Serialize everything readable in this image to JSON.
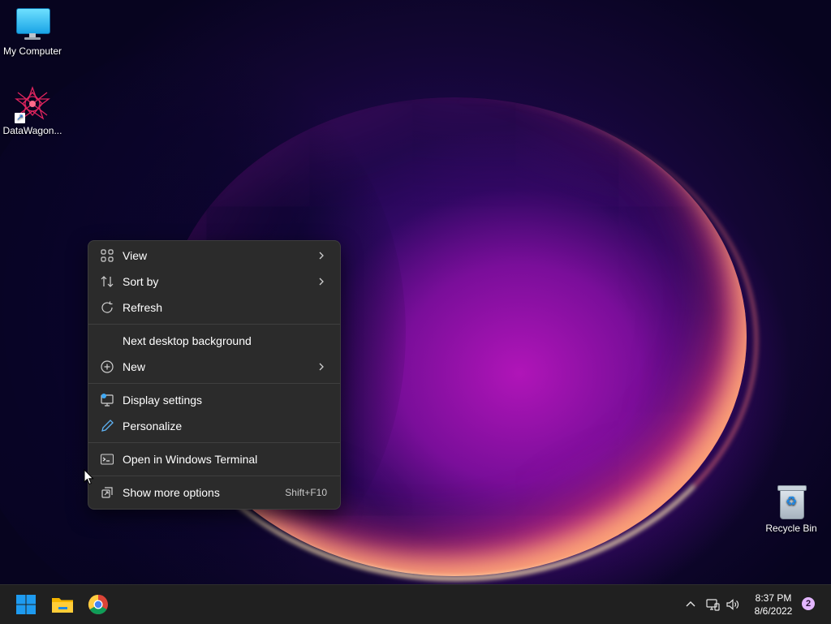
{
  "desktop": {
    "icons": [
      {
        "label": "My Computer"
      },
      {
        "label": "DataWagon..."
      },
      {
        "label": "Recycle Bin"
      }
    ]
  },
  "context_menu": {
    "items": [
      {
        "label": "View",
        "icon": "grid-view-icon",
        "submenu": true
      },
      {
        "label": "Sort by",
        "icon": "sort-icon",
        "submenu": true
      },
      {
        "label": "Refresh",
        "icon": "refresh-icon",
        "submenu": false
      },
      {
        "label": "Next desktop background",
        "icon": "",
        "submenu": false
      },
      {
        "label": "New",
        "icon": "plus-circle-icon",
        "submenu": true
      },
      {
        "label": "Display settings",
        "icon": "display-icon",
        "submenu": false
      },
      {
        "label": "Personalize",
        "icon": "pen-icon",
        "submenu": false
      },
      {
        "label": "Open in Windows Terminal",
        "icon": "terminal-icon",
        "submenu": false
      },
      {
        "label": "Show more options",
        "icon": "more-options-icon",
        "shortcut": "Shift+F10"
      }
    ]
  },
  "taskbar": {
    "apps": [
      "start-icon",
      "file-explorer-icon",
      "chrome-icon"
    ],
    "tray": [
      "chevron-up-icon",
      "network-icon",
      "volume-icon"
    ],
    "time": "8:37 PM",
    "date": "8/6/2022",
    "notification_count": "2"
  },
  "colors": {
    "menu_bg": "#2b2b2b",
    "taskbar_bg": "#202020",
    "accent": "#1e88e5"
  }
}
